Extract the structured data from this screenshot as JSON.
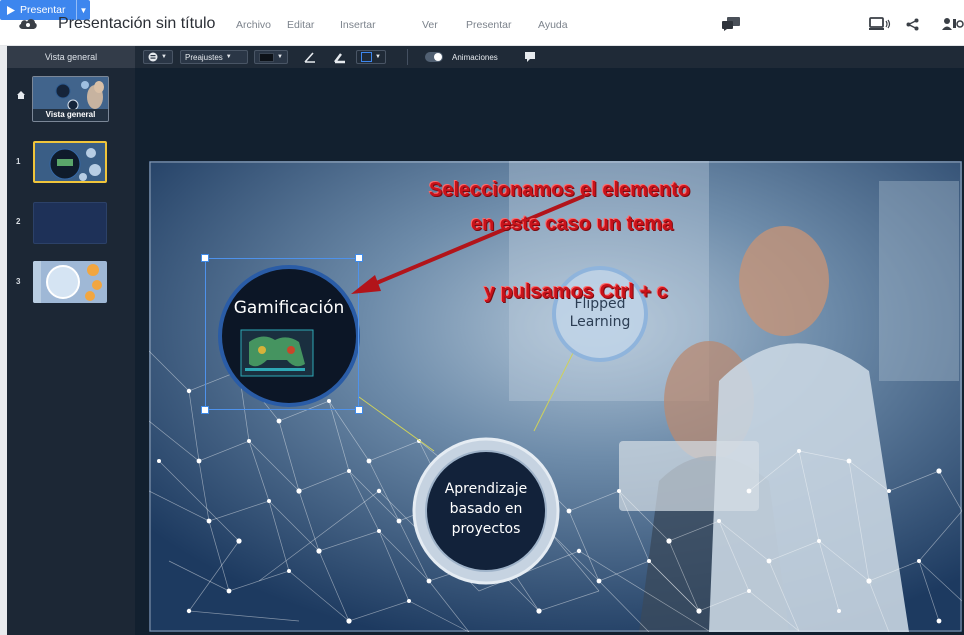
{
  "app": {
    "title": "Presentación sin título",
    "menu": [
      "Archivo",
      "Editar",
      "Insertar",
      "Ver",
      "Presentar",
      "Ayuda"
    ],
    "present_label": "Presentar"
  },
  "sidebar": {
    "header": "Vista general",
    "overview_label": "Vista general",
    "thumbnails": [
      {
        "number": "1",
        "selected": true
      },
      {
        "number": "2",
        "selected": false
      },
      {
        "number": "3",
        "selected": false
      }
    ]
  },
  "toolbar": {
    "presets_label": "Preajustes",
    "animations_label": "Animaciones"
  },
  "slide": {
    "topics": {
      "gamificacion": "Gamificación",
      "flipped_line1": "Flipped",
      "flipped_line2": "Learning",
      "aprendizaje_line1": "Aprendizaje",
      "aprendizaje_line2": "basado en",
      "aprendizaje_line3": "proyectos"
    },
    "annotation": {
      "line1": "Seleccionamos el elemento",
      "line2": "en este caso un tema",
      "line3": "y pulsamos Ctrl + c"
    }
  },
  "colors": {
    "accent": "#3d86ee",
    "annotation": "#c8121a",
    "sidebar": "#1c2735",
    "selected_thumb_border": "#f0c53b"
  }
}
